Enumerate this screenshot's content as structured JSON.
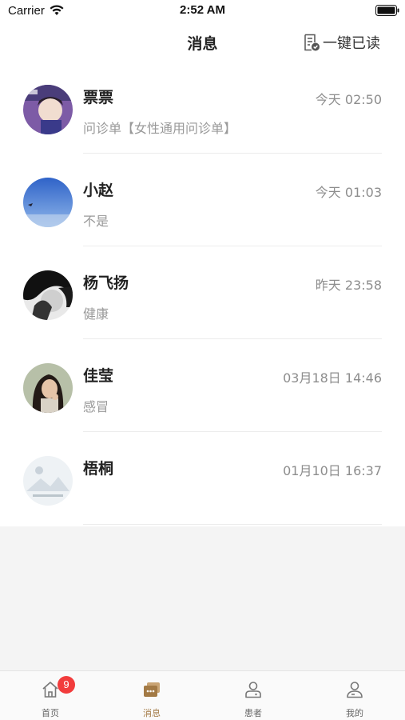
{
  "status_bar": {
    "carrier": "Carrier",
    "time": "2:52 AM"
  },
  "nav": {
    "title": "消息",
    "mark_all_read": "一键已读"
  },
  "messages": [
    {
      "name": "票票",
      "time": "今天 02:50",
      "preview": "问诊单【女性通用问诊单】"
    },
    {
      "name": "小赵",
      "time": "今天 01:03",
      "preview": "不是"
    },
    {
      "name": "杨飞扬",
      "time": "昨天 23:58",
      "preview": "健康"
    },
    {
      "name": "佳莹",
      "time": "03月18日 14:46",
      "preview": "感冒"
    },
    {
      "name": "梧桐",
      "time": "01月10日 16:37",
      "preview": ""
    }
  ],
  "tabs": [
    {
      "label": "首页",
      "icon": "home-icon",
      "badge": "9"
    },
    {
      "label": "消息",
      "icon": "message-icon"
    },
    {
      "label": "患者",
      "icon": "patient-icon"
    },
    {
      "label": "我的",
      "icon": "profile-icon"
    }
  ],
  "colors": {
    "accent": "#a37a45",
    "badge": "#f23c3c",
    "muted_text": "#999999",
    "background": "#f4f4f4"
  }
}
